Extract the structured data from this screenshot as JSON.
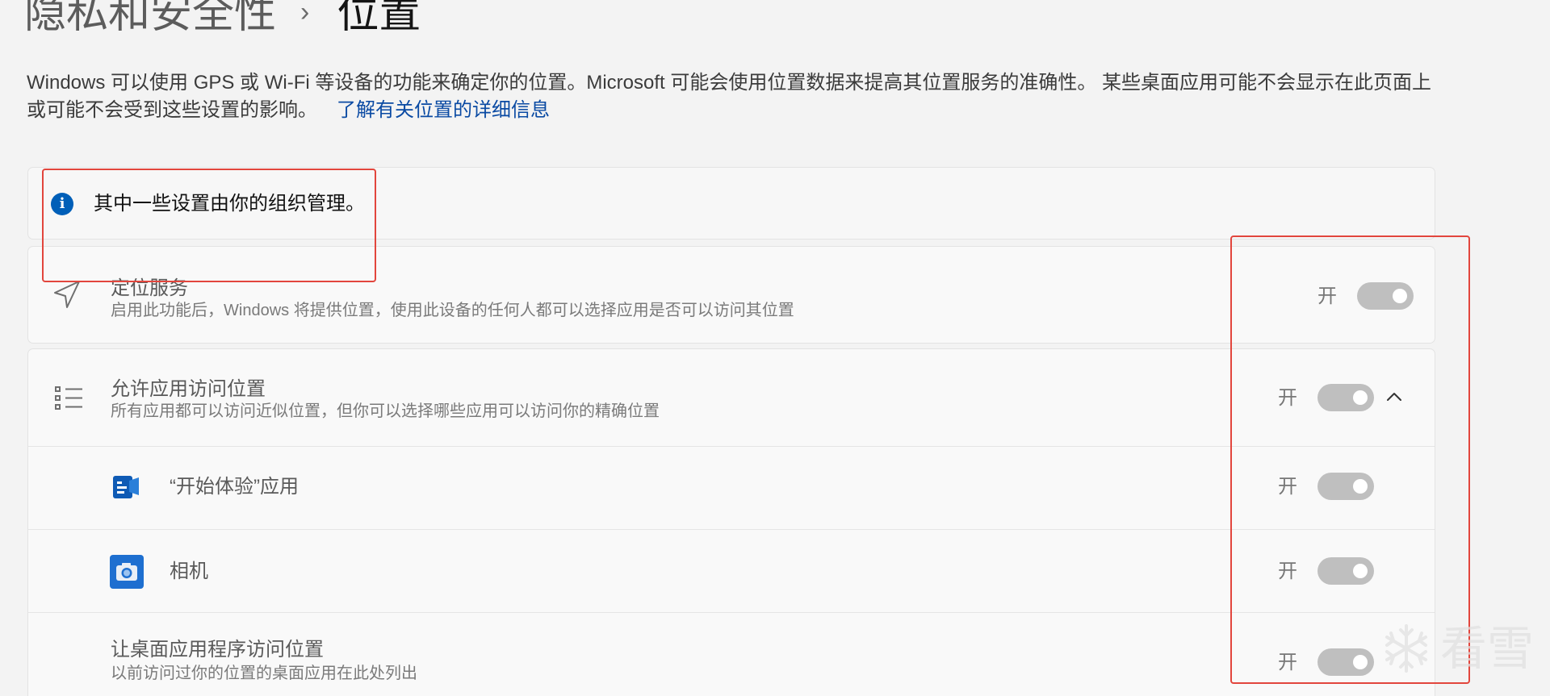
{
  "breadcrumb": {
    "parent": "隐私和安全性",
    "separator": "›",
    "current": "位置"
  },
  "description": {
    "text": "Windows 可以使用 GPS 或 Wi-Fi 等设备的功能来确定你的位置。Microsoft 可能会使用位置数据来提高其位置服务的准确性。 某些桌面应用可能不会显示在此页面上或可能不会受到这些设置的影响。",
    "link": "了解有关位置的详细信息"
  },
  "info_banner": {
    "icon": "info-icon",
    "text": "其中一些设置由你的组织管理。"
  },
  "location_service": {
    "icon": "location-arrow-icon",
    "title": "定位服务",
    "subtitle": "启用此功能后，Windows 将提供位置，使用此设备的任何人都可以选择应用是否可以访问其位置",
    "state_label": "开",
    "toggle_on": true
  },
  "app_access": {
    "icon": "list-icon",
    "title": "允许应用访问位置",
    "subtitle": "所有应用都可以访问近似位置，但你可以选择哪些应用可以访问你的精确位置",
    "state_label": "开",
    "toggle_on": true,
    "expanded": true,
    "chevron_icon": "chevron-up-icon",
    "apps": [
      {
        "icon": "get-started-app-icon",
        "name": "“开始体验”应用",
        "state_label": "开",
        "toggle_on": true
      },
      {
        "icon": "camera-app-icon",
        "name": "相机",
        "state_label": "开",
        "toggle_on": true
      }
    ]
  },
  "desktop_apps": {
    "title": "让桌面应用程序访问位置",
    "subtitle": "以前访问过你的位置的桌面应用在此处列出",
    "state_label": "开",
    "toggle_on": true
  },
  "watermark": {
    "text": "看雪",
    "icon": "snowflake-icon"
  },
  "colors": {
    "accent": "#005fb8",
    "link": "#0a4aa3",
    "toggle_disabled": "#bfbfbf",
    "annotation_red": "#e2463d",
    "background": "#f3f3f3"
  }
}
